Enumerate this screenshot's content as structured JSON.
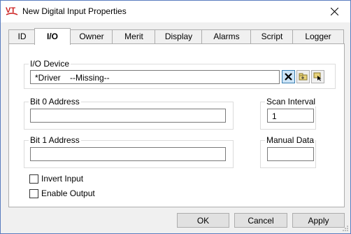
{
  "window": {
    "title": "New Digital Input Properties"
  },
  "tabs": [
    {
      "label": "ID"
    },
    {
      "label": "I/O"
    },
    {
      "label": "Owner"
    },
    {
      "label": "Merit"
    },
    {
      "label": "Display"
    },
    {
      "label": "Alarms"
    },
    {
      "label": "Script"
    },
    {
      "label": "Logger"
    }
  ],
  "active_tab": "I/O",
  "io_device": {
    "label": "I/O Device",
    "value": "*Driver    --Missing--"
  },
  "bit0": {
    "label": "Bit 0 Address",
    "value": ""
  },
  "bit1": {
    "label": "Bit 1 Address",
    "value": ""
  },
  "scan_interval": {
    "label": "Scan Interval",
    "value": "1"
  },
  "manual_data": {
    "label": "Manual Data",
    "value": ""
  },
  "checkboxes": {
    "invert_input": {
      "label": "Invert Input",
      "checked": false
    },
    "enable_output": {
      "label": "Enable Output",
      "checked": false
    }
  },
  "buttons": {
    "ok": "OK",
    "cancel": "Cancel",
    "apply": "Apply"
  },
  "icons": {
    "app": "vtscada-logo-icon",
    "clear": "clear-x-icon",
    "browse": "folder-browse-icon",
    "select": "select-pointer-icon"
  },
  "colors": {
    "accent": "#0078d7",
    "logo_red": "#cc1f1f",
    "pressed": "#cce4f7"
  }
}
